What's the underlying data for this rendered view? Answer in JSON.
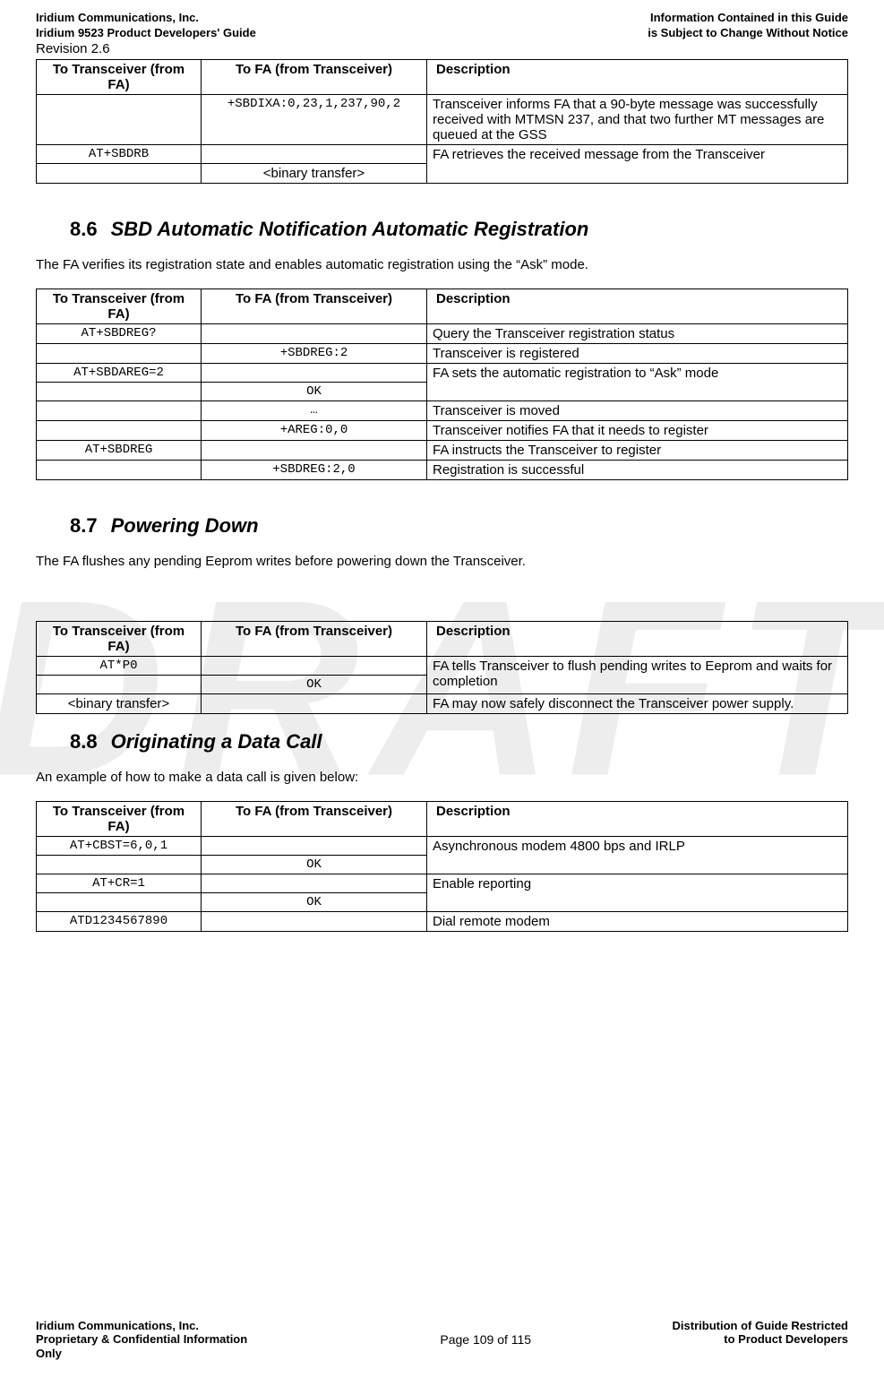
{
  "header": {
    "company": "Iridium Communications, Inc.",
    "guide": "Iridium 9523 Product Developers' Guide",
    "revision": "Revision 2.6",
    "info1": "Information Contained in this Guide",
    "info2": "is Subject to Change Without Notice"
  },
  "table1": {
    "h1": "To Transceiver (from FA)",
    "h2": "To FA (from Transceiver)",
    "h3": "Description",
    "r1c2": "+SBDIXA:0,23,1,237,90,2",
    "r1c3": "Transceiver informs FA that a 90-byte message was successfully received with MTMSN 237, and that two further MT messages are queued at the GSS",
    "r2c1": "AT+SBDRB",
    "r2c3": "FA retrieves the received message from the Transceiver",
    "r3c2": "<binary transfer>"
  },
  "sec86": {
    "num": "8.6",
    "title": "SBD Automatic Notification Automatic Registration",
    "para": "The FA verifies its registration state and enables automatic registration using the “Ask” mode."
  },
  "table2": {
    "h1": "To Transceiver (from FA)",
    "h2": "To FA (from Transceiver)",
    "h3": "Description",
    "r1c1": "AT+SBDREG?",
    "r1c3": "Query the Transceiver registration status",
    "r2c2": "+SBDREG:2",
    "r2c3": "Transceiver is registered",
    "r3c1": "AT+SBDAREG=2",
    "r3c3": "FA sets the automatic registration to “Ask” mode",
    "r4c2": "OK",
    "r5c2": "…",
    "r5c3": "Transceiver is moved",
    "r6c2": "+AREG:0,0",
    "r6c3": "Transceiver notifies FA that it needs to register",
    "r7c1": "AT+SBDREG",
    "r7c3": "FA instructs the Transceiver to register",
    "r8c2": "+SBDREG:2,0",
    "r8c3": "Registration is successful"
  },
  "sec87": {
    "num": "8.7",
    "title": "Powering Down",
    "para": "The FA flushes any pending Eeprom writes before powering down the Transceiver."
  },
  "table3": {
    "h1": "To Transceiver (from FA)",
    "h2": "To FA (from Transceiver)",
    "h3": "Description",
    "r1c1": "AT*P0",
    "r1c3": "FA tells Transceiver to flush pending writes to Eeprom and waits for completion",
    "r2c2": "OK",
    "r3c1": "<binary transfer>",
    "r3c3": "FA may now safely disconnect the Transceiver power supply."
  },
  "sec88": {
    "num": "8.8",
    "title": "Originating a Data Call",
    "para": "An example of how to make a data call is given below:"
  },
  "table4": {
    "h1": "To Transceiver (from FA)",
    "h2": "To FA (from Transceiver)",
    "h3": "Description",
    "r1c1": "AT+CBST=6,0,1",
    "r1c3": "Asynchronous modem 4800 bps and IRLP",
    "r2c2": "OK",
    "r3c1": "AT+CR=1",
    "r3c3": "Enable reporting",
    "r4c2": "OK",
    "r5c1": "ATD1234567890",
    "r5c3": "Dial remote modem"
  },
  "footer": {
    "company": "Iridium Communications, Inc.",
    "prop": "Proprietary & Confidential Information",
    "only": "Only",
    "page": "Page 109 of 115",
    "dist1": "Distribution of Guide Restricted",
    "dist2": "to Product Developers"
  }
}
